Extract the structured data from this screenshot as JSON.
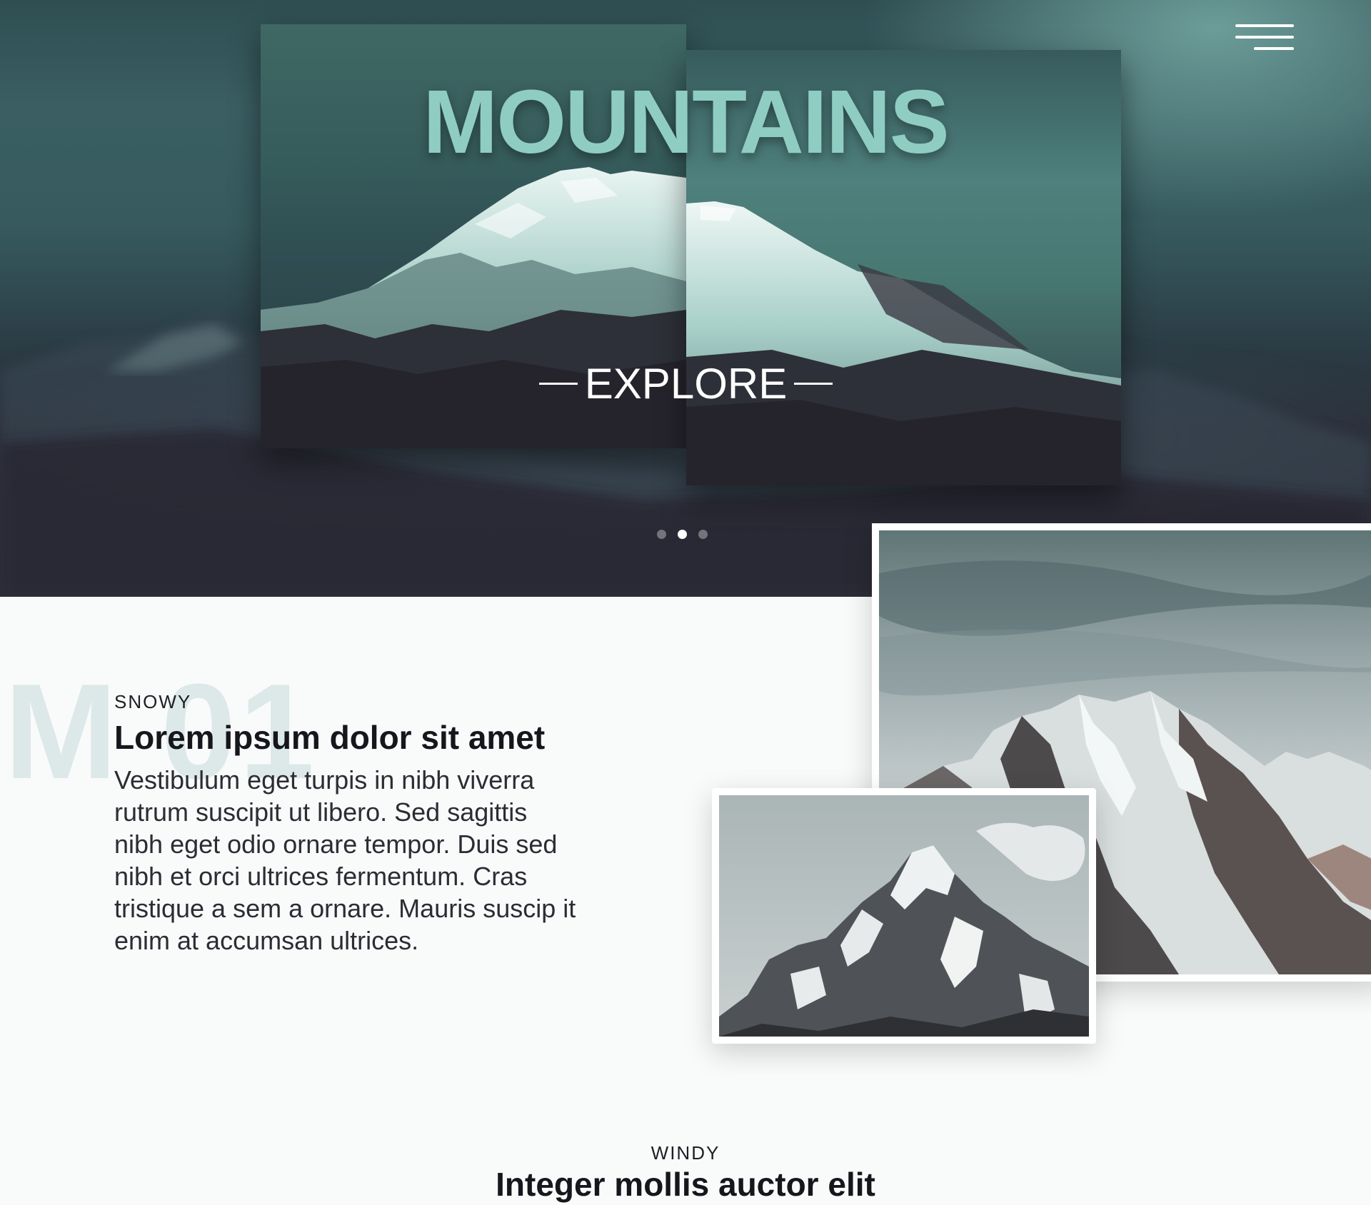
{
  "hero": {
    "title": "MOUNTAINS",
    "cta_label": "EXPLORE",
    "slides": [
      {
        "active": false
      },
      {
        "active": true
      },
      {
        "active": false
      }
    ]
  },
  "menu": {
    "icon": "hamburger-menu-icon"
  },
  "section_one": {
    "number": "M 01",
    "eyebrow": "SNOWY",
    "heading": "Lorem ipsum dolor sit amet",
    "body": "Vestibulum eget turpis in nibh viverra rutrum suscipit ut libero. Sed sagittis nibh eget odio ornare tempor. Duis sed nibh et orci ultrices fermentum. Cras tristique a sem a ornare. Mauris suscip it enim at accumsan ultrices."
  },
  "section_two": {
    "eyebrow": "WINDY",
    "heading": "Integer mollis auctor elit"
  },
  "colors": {
    "accent": "#8fcdc3",
    "hero_dark": "#2b2a34",
    "hero_teal": "#3a5f63",
    "page_bg": "#f9fbfb",
    "watermark": "#dde9e8"
  }
}
